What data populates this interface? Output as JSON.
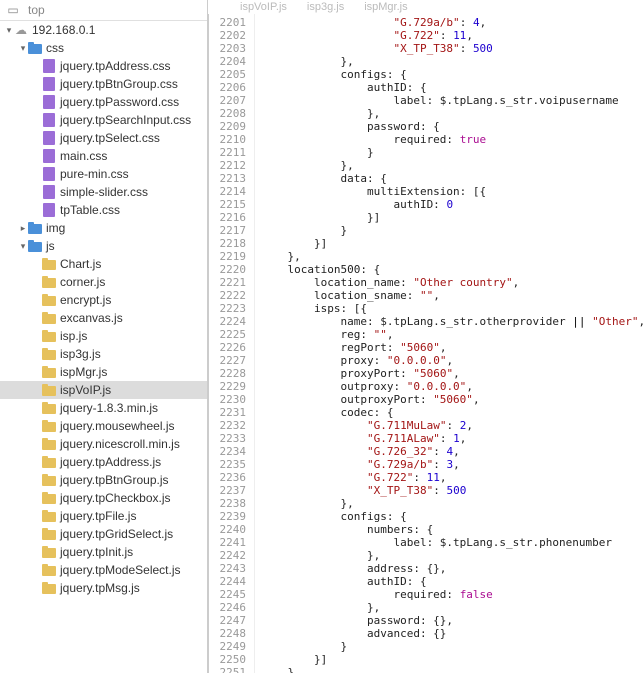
{
  "sidebar": {
    "header": "top",
    "root": "192.168.0.1",
    "folders": {
      "css": "css",
      "img": "img",
      "js": "js"
    },
    "css_files": [
      "jquery.tpAddress.css",
      "jquery.tpBtnGroup.css",
      "jquery.tpPassword.css",
      "jquery.tpSearchInput.css",
      "jquery.tpSelect.css",
      "main.css",
      "pure-min.css",
      "simple-slider.css",
      "tpTable.css"
    ],
    "js_files": [
      "Chart.js",
      "corner.js",
      "encrypt.js",
      "excanvas.js",
      "isp.js",
      "isp3g.js",
      "ispMgr.js",
      "ispVoIP.js",
      "jquery-1.8.3.min.js",
      "jquery.mousewheel.js",
      "jquery.nicescroll.min.js",
      "jquery.tpAddress.js",
      "jquery.tpBtnGroup.js",
      "jquery.tpCheckbox.js",
      "jquery.tpFile.js",
      "jquery.tpGridSelect.js",
      "jquery.tpInit.js",
      "jquery.tpModeSelect.js",
      "jquery.tpMsg.js"
    ],
    "selected_file": "ispVoIP.js"
  },
  "tabs": [
    "ispVoIP.js",
    "isp3g.js",
    "ispMgr.js"
  ],
  "code": {
    "first_line": 2201,
    "lines": [
      "                    \"G.729a/b\": 4,",
      "                    \"G.722\": 11,",
      "                    \"X_TP_T38\": 500",
      "            },",
      "            configs: {",
      "                authID: {",
      "                    label: $.tpLang.s_str.voipusername",
      "                },",
      "                password: {",
      "                    required: true",
      "                }",
      "            },",
      "            data: {",
      "                multiExtension: [{",
      "                    authID: 0",
      "                }]",
      "            }",
      "        }]",
      "    },",
      "    location500: {",
      "        location_name: \"Other country\",",
      "        location_sname: \"\",",
      "        isps: [{",
      "            name: $.tpLang.s_str.otherprovider || \"Other\",",
      "            reg: \"\",",
      "            regPort: \"5060\",",
      "            proxy: \"0.0.0.0\",",
      "            proxyPort: \"5060\",",
      "            outproxy: \"0.0.0.0\",",
      "            outproxyPort: \"5060\",",
      "            codec: {",
      "                \"G.711MuLaw\": 2,",
      "                \"G.711ALaw\": 1,",
      "                \"G.726_32\": 4,",
      "                \"G.729a/b\": 3,",
      "                \"G.722\": 11,",
      "                \"X_TP_T38\": 500",
      "            },",
      "            configs: {",
      "                numbers: {",
      "                    label: $.tpLang.s_str.phonenumber",
      "                },",
      "                address: {},",
      "                authID: {",
      "                    required: false",
      "                },",
      "                password: {},",
      "                advanced: {}",
      "            }",
      "        }]",
      "    }",
      "}"
    ]
  }
}
